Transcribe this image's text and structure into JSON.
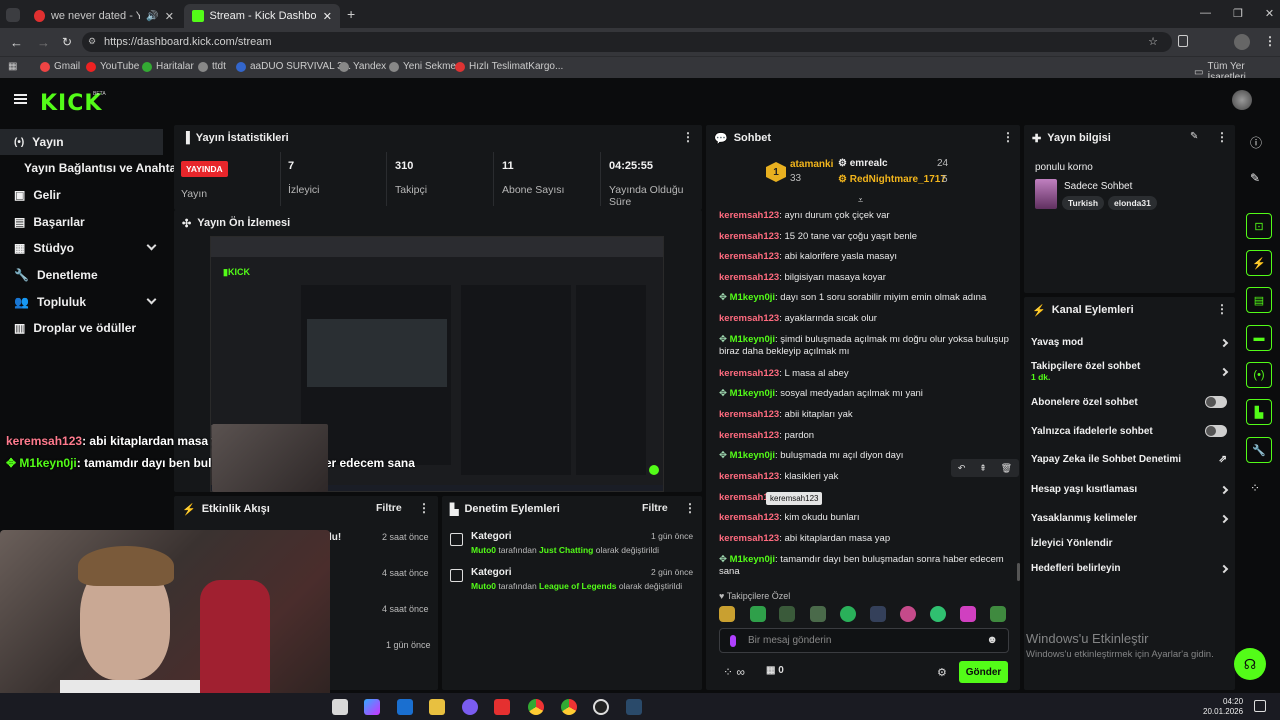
{
  "browser": {
    "tabs": [
      {
        "title": "we never dated - YouTube"
      },
      {
        "title": "Stream - Kick Dashboard"
      }
    ],
    "new_tab_icon": "plus-icon",
    "url": "https://dashboard.kick.com/stream",
    "bookmarks": [
      "Gmail",
      "YouTube",
      "Haritalar",
      "ttdt",
      "aaDUO SURVIVAL 3...",
      "Yandex",
      "Yeni Sekme",
      "Hızlı TeslimatKargo..."
    ],
    "bookmarks_right": "Tüm Yer İşaretleri"
  },
  "app": {
    "logo": "KICK",
    "logo_badge": "BETA"
  },
  "sidebar": {
    "items": [
      {
        "label": "Yayın"
      },
      {
        "label": "Yayın Bağlantısı ve Anahtarı"
      },
      {
        "label": "Gelir"
      },
      {
        "label": "Başarılar"
      },
      {
        "label": "Stüdyo"
      },
      {
        "label": "Denetleme"
      },
      {
        "label": "Topluluk"
      },
      {
        "label": "Droplar ve ödüller"
      }
    ]
  },
  "stats": {
    "title": "Yayın İstatistikleri",
    "live_badge": "YAYINDA",
    "live_label": "Yayın",
    "viewers": {
      "value": "7",
      "label": "İzleyici"
    },
    "followers": {
      "value": "310",
      "label": "Takipçi"
    },
    "subs": {
      "value": "11",
      "label": "Abone Sayısı"
    },
    "duration": {
      "value": "04:25:55",
      "label": "Yayında Olduğu Süre"
    }
  },
  "preview": {
    "title": "Yayın Ön İzlemesi"
  },
  "overlay": {
    "line1_user": "keremsah123",
    "line1_text": ": abi kitaplardan masa yap",
    "line2_user": "M1keyn0ji",
    "line2_text": ": tamamdır dayı ben buluşmadan sonra haber edecem sana"
  },
  "activity": {
    "title": "Etkinlik Akışı",
    "filter": "Filtre",
    "partial_text": "lu!",
    "times": [
      "2 saat önce",
      "4 saat önce",
      "4 saat önce",
      "1 gün önce"
    ]
  },
  "moderation": {
    "title": "Denetim Eylemleri",
    "filter": "Filtre",
    "items": [
      {
        "title": "Kategori",
        "time": "1 gün önce",
        "actor": "Muto0",
        "mid": " tarafından ",
        "target": "Just Chatting",
        "end": " olarak değiştirildi"
      },
      {
        "title": "Kategori",
        "time": "2 gün önce",
        "actor": "Muto0",
        "mid": " tarafından ",
        "target": "League of Legends",
        "end": " olarak değiştirildi"
      }
    ]
  },
  "chat": {
    "title": "Sohbet",
    "top": [
      {
        "rank": "1",
        "name": "atamanki",
        "count": "33"
      },
      {
        "name": "emrealc",
        "count": "24"
      },
      {
        "name": "RedNightmare_1717",
        "count": "5"
      }
    ],
    "messages": [
      {
        "user": "keremsah123",
        "type": "u1",
        "text": ": aynı durum çok çiçek var"
      },
      {
        "user": "keremsah123",
        "type": "u1",
        "text": ": 15 20 tane var çoğu yaşıt benle"
      },
      {
        "user": "keremsah123",
        "type": "u1",
        "text": ": abi kalorifere yasla masayı"
      },
      {
        "user": "keremsah123",
        "type": "u1",
        "text": ": bilgisiyarı masaya koyar"
      },
      {
        "user": "M1keyn0ji",
        "type": "u2",
        "text": ": dayı son 1 soru sorabilir miyim emin olmak adına"
      },
      {
        "user": "keremsah123",
        "type": "u1",
        "text": ": ayaklarında sıcak olur"
      },
      {
        "user": "M1keyn0ji",
        "type": "u2",
        "text": ": şimdi buluşmada açılmak mı doğru olur yoksa buluşup biraz daha bekleyip açılmak mı"
      },
      {
        "user": "keremsah123",
        "type": "u1",
        "text": ": L masa al abey"
      },
      {
        "user": "M1keyn0ji",
        "type": "u2",
        "text": ": sosyal medyadan açılmak mı yani"
      },
      {
        "user": "keremsah123",
        "type": "u1",
        "text": ": abii kitapları yak"
      },
      {
        "user": "keremsah123",
        "type": "u1",
        "text": ": pardon"
      },
      {
        "user": "M1keyn0ji",
        "type": "u2",
        "text": ": buluşmada mı açıl diyon dayı"
      },
      {
        "user": "keremsah123",
        "type": "u1",
        "text": ": klasikleri yak"
      },
      {
        "user": "keremsah123",
        "type": "u1",
        "text": ": yak"
      },
      {
        "user": "keremsah123",
        "type": "u1",
        "text": ": kim okudu bunları"
      },
      {
        "user": "keremsah123",
        "type": "u1",
        "text": ": abi kitaplardan masa yap"
      },
      {
        "user": "M1keyn0ji",
        "type": "u2",
        "text": ": tamamdır dayı ben buluşmadan sonra haber edecem sana"
      }
    ],
    "tooltip": "keremsah123",
    "followers_only": "Takipçilere Özel",
    "input_placeholder": "Bir mesaj gönderin",
    "points": "∞",
    "gift_count": "0",
    "send": "Gönder"
  },
  "info": {
    "title": "Yayın bilgisi",
    "stream_title": "ponulu korno",
    "category": "Sadece Sohbet",
    "tags": [
      "Turkish",
      "elonda31"
    ]
  },
  "channel": {
    "title": "Kanal Eylemleri",
    "items": [
      {
        "label": "Yavaş mod"
      },
      {
        "label": "Takipçilere özel sohbet",
        "sub": "1 dk."
      },
      {
        "label": "Abonelere özel sohbet"
      },
      {
        "label": "Yalnızca ifadelerle sohbet"
      },
      {
        "label": "Yapay Zeka ile Sohbet Denetimi"
      },
      {
        "label": "Hesap yaşı kısıtlaması"
      },
      {
        "label": "Yasaklanmış kelimeler"
      },
      {
        "label": "İzleyici Yönlendir"
      },
      {
        "label": "Hedefleri belirleyin"
      }
    ]
  },
  "watermark": {
    "title": "Windows'u Etkinleştir",
    "sub": "Windows'u etkinleştirmek için Ayarlar'a gidin."
  },
  "taskbar": {
    "time": "04:20",
    "date": "20.01.2026"
  },
  "colors": {
    "accent": "#53fc18",
    "panel": "#151719",
    "bg": "#0b0c0d"
  }
}
